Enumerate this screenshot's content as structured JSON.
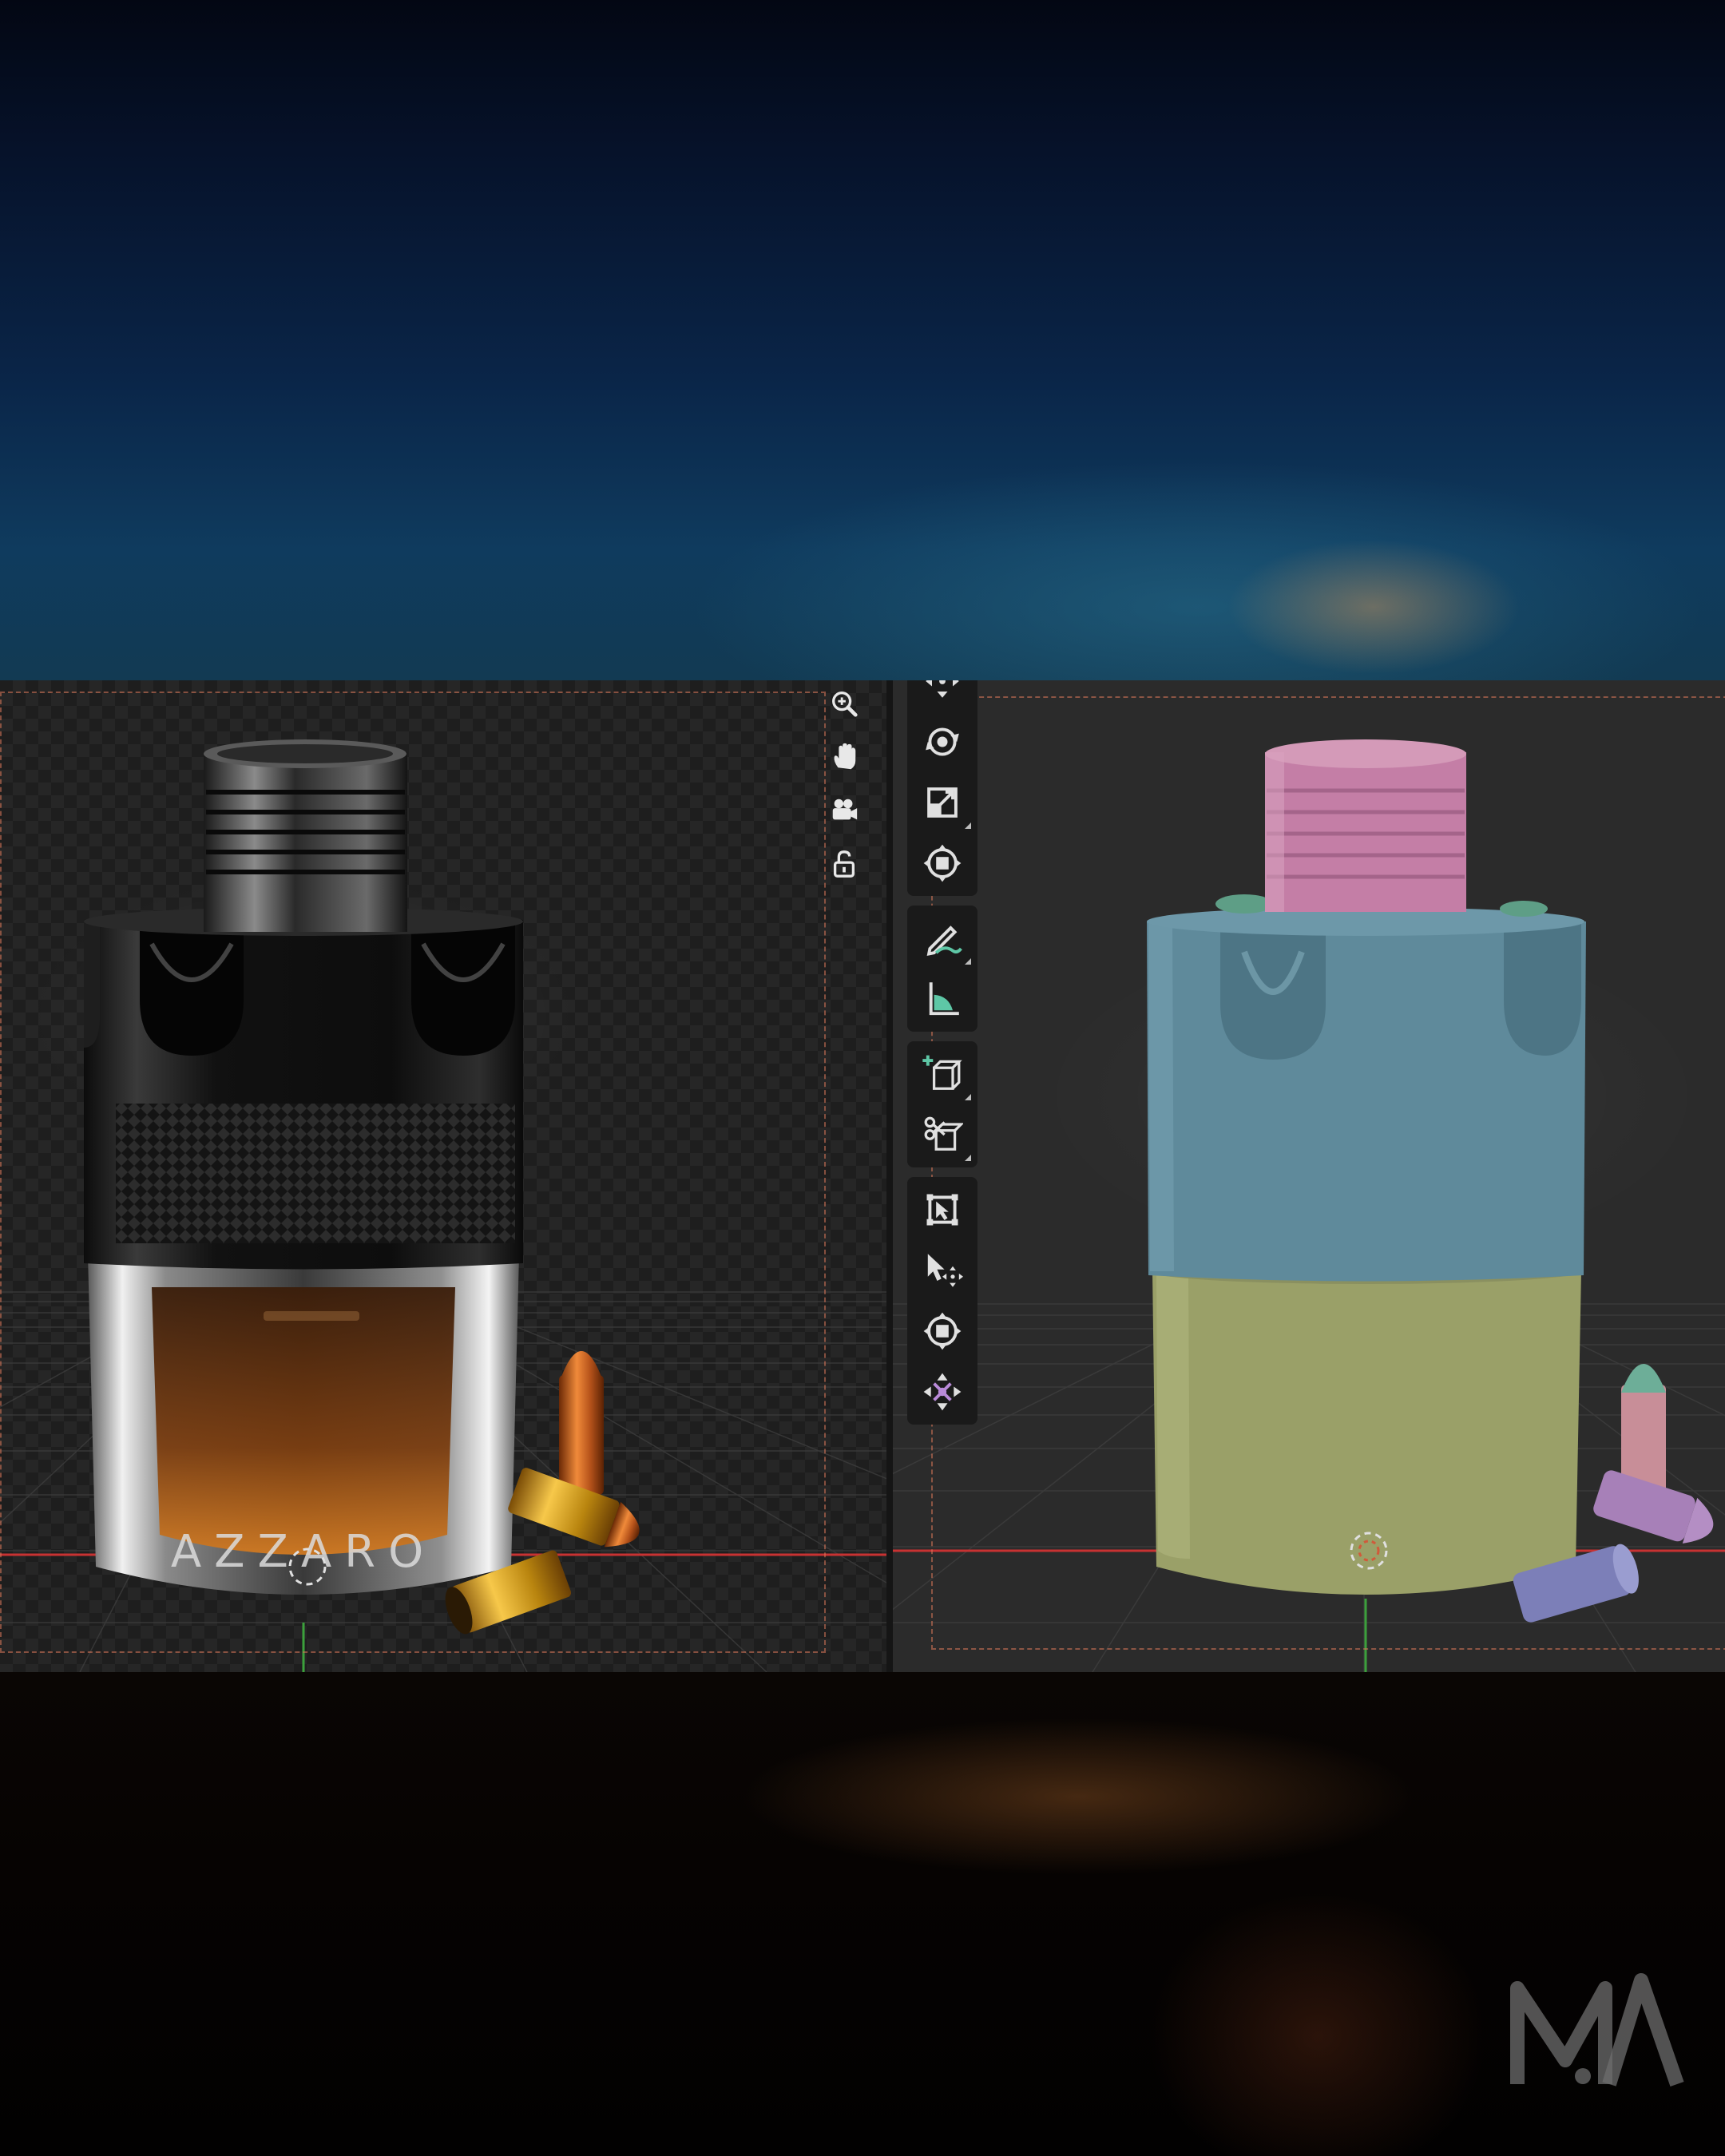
{
  "left_viewport": {
    "render_mode": "rendered",
    "nav_gizmo": [
      {
        "icon": "zoom-icon"
      },
      {
        "icon": "hand-pan-icon"
      },
      {
        "icon": "camera-view-icon"
      },
      {
        "icon": "lock-icon"
      }
    ],
    "label_text": "AZZARO"
  },
  "right_viewport": {
    "render_mode": "solid",
    "toolbar": {
      "groups": [
        [
          {
            "icon": "move-icon"
          },
          {
            "icon": "rotate-icon"
          },
          {
            "icon": "scale-icon"
          },
          {
            "icon": "transform-icon"
          }
        ],
        [
          {
            "icon": "annotate-icon"
          },
          {
            "icon": "measure-icon"
          }
        ],
        [
          {
            "icon": "add-cube-icon"
          },
          {
            "icon": "knife-icon"
          }
        ],
        [
          {
            "icon": "select-box-icon"
          },
          {
            "icon": "cursor-icon"
          },
          {
            "icon": "transform-icon-2"
          },
          {
            "icon": "move-axes-icon"
          }
        ]
      ]
    },
    "object_colors": {
      "cap": "#c47ea6",
      "collar": "#5f8a9b",
      "base": "#9aa068",
      "dots": "#5e9e86",
      "bullet_tip": "#6dae98",
      "bullet_case_pink": "#c88e98",
      "bullet_lilac": "#a780b8",
      "bullet_blue": "#7c7fb8"
    }
  },
  "logo": {
    "icon": "ma-logo-icon"
  },
  "colors": {
    "axis_x": "#c83232",
    "axis_y": "#3ca03c",
    "camera_frame": "#dc785a"
  }
}
